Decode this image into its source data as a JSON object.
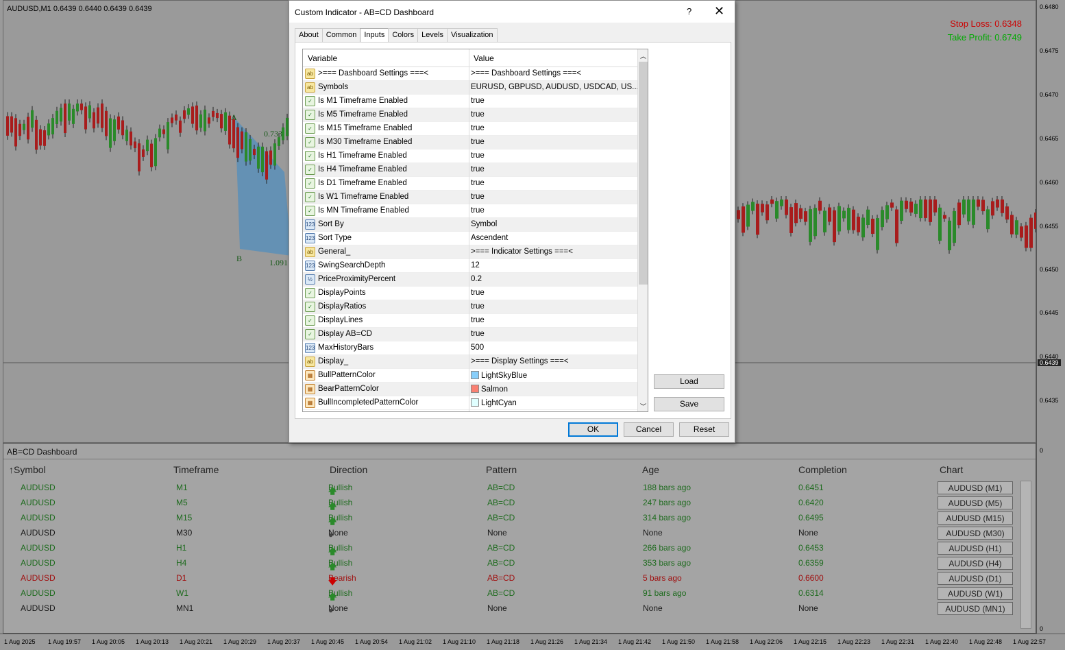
{
  "chart": {
    "symbol_header": "AUDUSD,M1  0.6439 0.6440 0.6439 0.6439",
    "stop_loss": "Stop Loss: 0.6348",
    "take_profit": "Take Profit: 0.6749",
    "label_a": "A",
    "label_b": "B",
    "ratio1": "0.733",
    "ratio2": "1.091",
    "current_price": "0.6439",
    "price_labels": [
      "0.6480",
      "0.6475",
      "0.6470",
      "0.6465",
      "0.6460",
      "0.6455",
      "0.6450",
      "0.6445",
      "0.6440",
      "0.6435",
      "0"
    ],
    "axis_zero_bottom": "0",
    "time_labels": [
      "1 Aug 2025",
      "1 Aug 19:57",
      "1 Aug 20:05",
      "1 Aug 20:13",
      "1 Aug 20:21",
      "1 Aug 20:29",
      "1 Aug 20:37",
      "1 Aug 20:45",
      "1 Aug 20:54",
      "1 Aug 21:02",
      "1 Aug 21:10",
      "1 Aug 21:18",
      "1 Aug 21:26",
      "1 Aug 21:34",
      "1 Aug 21:42",
      "1 Aug 21:50",
      "1 Aug 21:58",
      "1 Aug 22:06",
      "1 Aug 22:15",
      "1 Aug 22:23",
      "1 Aug 22:31",
      "1 Aug 22:40",
      "1 Aug 22:48",
      "1 Aug 22:57"
    ],
    "colors": {
      "bull": "#2a8a2a",
      "bear": "#a81c1c",
      "pattern": "#5b8fb8"
    }
  },
  "dialog": {
    "title": "Custom Indicator - AB=CD Dashboard",
    "help": "?",
    "close": "✕",
    "tabs": [
      "About",
      "Common",
      "Inputs",
      "Colors",
      "Levels",
      "Visualization"
    ],
    "active_tab": "Inputs",
    "col_variable": "Variable",
    "col_value": "Value",
    "rows": [
      {
        "icon": "ab",
        "var": ">=== Dashboard Settings ===<",
        "val": ">=== Dashboard Settings ===<"
      },
      {
        "icon": "ab",
        "var": "Symbols",
        "val": "EURUSD, GBPUSD, AUDUSD, USDCAD, US..."
      },
      {
        "icon": "bool",
        "var": "Is M1 Timeframe Enabled",
        "val": "true"
      },
      {
        "icon": "bool",
        "var": "Is M5 Timeframe Enabled",
        "val": "true"
      },
      {
        "icon": "bool",
        "var": "Is M15 Timeframe Enabled",
        "val": "true"
      },
      {
        "icon": "bool",
        "var": "Is M30 Timeframe Enabled",
        "val": "true"
      },
      {
        "icon": "bool",
        "var": "Is H1 Timeframe Enabled",
        "val": "true"
      },
      {
        "icon": "bool",
        "var": "Is H4 Timeframe Enabled",
        "val": "true"
      },
      {
        "icon": "bool",
        "var": "Is D1 Timeframe Enabled",
        "val": "true"
      },
      {
        "icon": "bool",
        "var": "Is W1 Timeframe Enabled",
        "val": "true"
      },
      {
        "icon": "bool",
        "var": "Is MN Timeframe Enabled",
        "val": "true"
      },
      {
        "icon": "123",
        "var": "Sort By",
        "val": "Symbol"
      },
      {
        "icon": "123",
        "var": "Sort Type",
        "val": "Ascendent"
      },
      {
        "icon": "ab",
        "var": "General_",
        "val": ">=== Indicator Settings ===<"
      },
      {
        "icon": "123",
        "var": "SwingSearchDepth",
        "val": "12"
      },
      {
        "icon": "half",
        "var": "PriceProximityPercent",
        "val": "0.2"
      },
      {
        "icon": "bool",
        "var": "DisplayPoints",
        "val": "true"
      },
      {
        "icon": "bool",
        "var": "DisplayRatios",
        "val": "true"
      },
      {
        "icon": "bool",
        "var": "DisplayLines",
        "val": "true"
      },
      {
        "icon": "bool",
        "var": "Display AB=CD",
        "val": "true"
      },
      {
        "icon": "123",
        "var": "MaxHistoryBars",
        "val": "500"
      },
      {
        "icon": "ab",
        "var": "Display_",
        "val": ">=== Display Settings ===<"
      },
      {
        "icon": "color",
        "var": "BullPatternColor",
        "val": "LightSkyBlue",
        "swatch": "#87cefa"
      },
      {
        "icon": "color",
        "var": "BearPatternColor",
        "val": "Salmon",
        "swatch": "#fa8072"
      },
      {
        "icon": "color",
        "var": "BullIncompletedPatternColor",
        "val": "LightCyan",
        "swatch": "#e0ffff"
      }
    ],
    "load": "Load",
    "save": "Save",
    "ok": "OK",
    "cancel": "Cancel",
    "reset": "Reset"
  },
  "dashboard": {
    "title": "AB=CD Dashboard",
    "headers": [
      "↑Symbol",
      "Timeframe",
      "Direction",
      "Pattern",
      "Age",
      "Completion",
      "Chart"
    ],
    "rows": [
      {
        "symbol": "AUDUSD",
        "tf": "M1",
        "dir": "Bullish",
        "dir_kind": "up",
        "pattern": "AB=CD",
        "age": "188 bars ago",
        "completion": "0.6451",
        "chart": "AUDUSD (M1)"
      },
      {
        "symbol": "AUDUSD",
        "tf": "M5",
        "dir": "Bullish",
        "dir_kind": "up",
        "pattern": "AB=CD",
        "age": "247 bars ago",
        "completion": "0.6420",
        "chart": "AUDUSD (M5)"
      },
      {
        "symbol": "AUDUSD",
        "tf": "M15",
        "dir": "Bullish",
        "dir_kind": "up",
        "pattern": "AB=CD",
        "age": "314 bars ago",
        "completion": "0.6495",
        "chart": "AUDUSD (M15)"
      },
      {
        "symbol": "AUDUSD",
        "tf": "M30",
        "dir": "None",
        "dir_kind": "none",
        "pattern": "None",
        "age": "None",
        "completion": "None",
        "chart": "AUDUSD (M30)"
      },
      {
        "symbol": "AUDUSD",
        "tf": "H1",
        "dir": "Bullish",
        "dir_kind": "up",
        "pattern": "AB=CD",
        "age": "266 bars ago",
        "completion": "0.6453",
        "chart": "AUDUSD (H1)"
      },
      {
        "symbol": "AUDUSD",
        "tf": "H4",
        "dir": "Bullish",
        "dir_kind": "up",
        "pattern": "AB=CD",
        "age": "353 bars ago",
        "completion": "0.6359",
        "chart": "AUDUSD (H4)"
      },
      {
        "symbol": "AUDUSD",
        "tf": "D1",
        "dir": "Bearish",
        "dir_kind": "down",
        "pattern": "AB=CD",
        "age": "5 bars ago",
        "completion": "0.6600",
        "chart": "AUDUSD (D1)"
      },
      {
        "symbol": "AUDUSD",
        "tf": "W1",
        "dir": "Bullish",
        "dir_kind": "up",
        "pattern": "AB=CD",
        "age": "91 bars ago",
        "completion": "0.6314",
        "chart": "AUDUSD (W1)"
      },
      {
        "symbol": "AUDUSD",
        "tf": "MN1",
        "dir": "None",
        "dir_kind": "none",
        "pattern": "None",
        "age": "None",
        "completion": "None",
        "chart": "AUDUSD (MN1)"
      }
    ],
    "colors": {
      "up": "#1e6b1e",
      "down": "#a01010",
      "none": "#1a1a1a"
    }
  }
}
